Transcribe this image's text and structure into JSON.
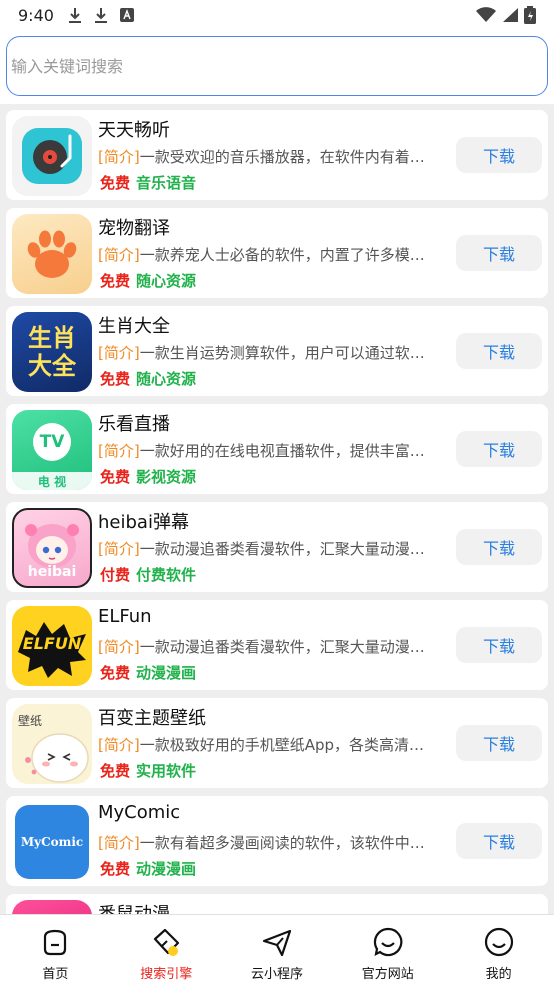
{
  "status": {
    "time": "9:40"
  },
  "search": {
    "placeholder": "输入关键词搜索"
  },
  "apps": [
    {
      "name": "天天畅听",
      "tag": "[简介]",
      "desc": "一款受欢迎的音乐播放器，在软件内有着…",
      "price": "免费",
      "category": "音乐语音",
      "button": "下载",
      "icon": "turntable-icon"
    },
    {
      "name": "宠物翻译",
      "tag": "[简介]",
      "desc": "一款养宠人士必备的软件，内置了许多模…",
      "price": "免费",
      "category": "随心资源",
      "button": "下载",
      "icon": "paw-icon"
    },
    {
      "name": "生肖大全",
      "tag": "[简介]",
      "desc": "一款生肖运势测算软件，用户可以通过软…",
      "price": "免费",
      "category": "随心资源",
      "button": "下载",
      "icon": "zodiac-icon",
      "icon_text": [
        "生肖",
        "大全"
      ]
    },
    {
      "name": "乐看直播",
      "tag": "[简介]",
      "desc": "一款好用的在线电视直播软件，提供丰富…",
      "price": "免费",
      "category": "影视资源",
      "button": "下载",
      "icon": "tv-icon",
      "icon_text": [
        "TV",
        "电 视"
      ]
    },
    {
      "name": "heibai弹幕",
      "tag": "[简介]",
      "desc": "一款动漫追番类看漫软件，汇聚大量动漫…",
      "price": "付费",
      "category": "付费软件",
      "button": "下载",
      "icon": "anime-girl-icon",
      "icon_text": [
        "heibai"
      ]
    },
    {
      "name": "ELFun",
      "tag": "[简介]",
      "desc": "一款动漫追番类看漫软件，汇聚大量动漫…",
      "price": "免费",
      "category": "动漫漫画",
      "button": "下载",
      "icon": "elfun-logo-icon",
      "icon_text": [
        "ELFUN"
      ]
    },
    {
      "name": "百变主题壁纸",
      "tag": "[简介]",
      "desc": "一款极致好用的手机壁纸App，各类高清…",
      "price": "免费",
      "category": "实用软件",
      "button": "下载",
      "icon": "wallpaper-cat-icon",
      "icon_text": [
        "壁纸"
      ]
    },
    {
      "name": "MyComic",
      "tag": "[简介]",
      "desc": "一款有着超多漫画阅读的软件，该软件中…",
      "price": "免费",
      "category": "动漫漫画",
      "button": "下载",
      "icon": "mycomic-logo-icon",
      "icon_text": [
        "MyComic"
      ]
    },
    {
      "name": "番鼠动漫",
      "partial": true,
      "icon": "anime-icon"
    }
  ],
  "tabs": [
    {
      "label": "首页",
      "icon": "home-icon",
      "active": false
    },
    {
      "label": "搜索引擎",
      "icon": "search-engine-icon",
      "active": true
    },
    {
      "label": "云小程序",
      "icon": "paper-plane-icon",
      "active": false
    },
    {
      "label": "官方网站",
      "icon": "chat-smile-icon",
      "active": false
    },
    {
      "label": "我的",
      "icon": "smile-icon",
      "active": false
    }
  ],
  "colors": {
    "accent": "#4f86e8",
    "free": "#e8241b",
    "category": "#21b24b",
    "tag": "#f08a24",
    "download": "#2a7fe0",
    "active_tab": "#e8241b"
  }
}
